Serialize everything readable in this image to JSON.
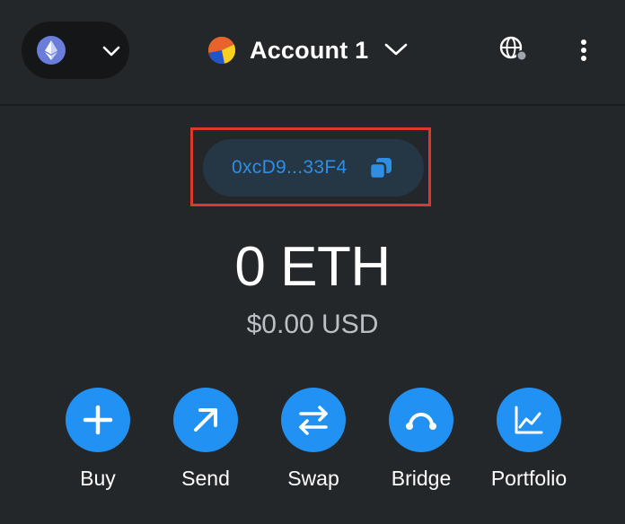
{
  "header": {
    "network_icon": "ethereum-icon",
    "account_name": "Account 1",
    "globe_icon": "globe-icon",
    "menu_icon": "kebab-menu-icon"
  },
  "address": {
    "short": "0xcD9...33F4",
    "copy_icon": "copy-icon"
  },
  "balance": {
    "primary": "0 ETH",
    "fiat": "$0.00 USD"
  },
  "actions": [
    {
      "label": "Buy",
      "icon": "plus-icon"
    },
    {
      "label": "Send",
      "icon": "arrow-up-right-icon"
    },
    {
      "label": "Swap",
      "icon": "swap-arrows-icon"
    },
    {
      "label": "Bridge",
      "icon": "bridge-icon"
    },
    {
      "label": "Portfolio",
      "icon": "chart-line-icon"
    }
  ],
  "colors": {
    "background": "#24272a",
    "primary": "#2191f3",
    "address_text": "#2f8ee3",
    "address_pill": "#253745",
    "highlight": "#d93a2b",
    "muted_text": "#bbc0c5"
  }
}
